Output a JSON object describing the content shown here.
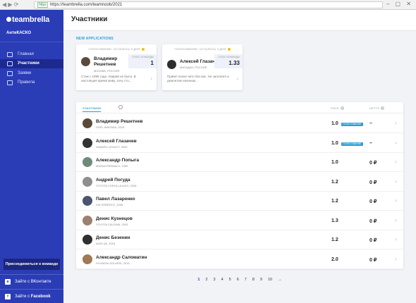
{
  "browser": {
    "nav": "◀ ▶ ⟳",
    "secure": "https",
    "url": "https://teambrella.com/teamnoob/2021",
    "controls": "– ▢ ✕"
  },
  "sidebar": {
    "logo": "teambrella",
    "team": "АнтиКАСКО",
    "items": [
      {
        "label": "Главная",
        "icon": "home-icon"
      },
      {
        "label": "Участники",
        "icon": "users-icon",
        "active": true
      },
      {
        "label": "Заявки",
        "icon": "claims-icon"
      },
      {
        "label": "Правила",
        "icon": "rules-icon"
      }
    ],
    "join_button": "Присоединиться к команде",
    "vk": "Зайти с ВКонтакте",
    "fb_prefix": "Зайти с ",
    "fb_brand": "Facebook"
  },
  "header": {
    "title": "Участники"
  },
  "applications": {
    "label": "NEW APPLICATIONS",
    "cards": [
      {
        "status": "ГОЛОСОВАНИЕ: ОСТАЛОСЬ 3 ДНЯ",
        "name": "Владимир Решетнев",
        "city": "МОСКВА, РОССИЯ",
        "vote_label": "ГОЛОС КОМАНДЫ",
        "vote": "1",
        "message": "Стаж с 1995 года. Аварий на было. В настоящее время живу, хочу сто..."
      },
      {
        "status": "ГОЛОСОВАНИЕ: ОСТАЛОСЬ 3 ДНЯ",
        "name": "Алексей Глазачев",
        "city": "МАГАДАН, РОССИЯ",
        "vote_label": "ГОЛОС КОМАНДЫ",
        "vote": "1.33",
        "message": "Привет всем! Авто без вас. Не заплатил и демонтаж начинаю..."
      }
    ]
  },
  "members": {
    "col_members": "УЧАСТНИКИ",
    "col_risk": "РИСК",
    "col_net": "НЕТТО",
    "help": "?",
    "rows": [
      {
        "name": "Владимир Решетнев",
        "car": "OPEL INSIGNIA, 2015",
        "risk": "1.0",
        "badge": "ГОЛОСОВАНИЕ",
        "net": "–",
        "avatar_color": "#5b4a3a"
      },
      {
        "name": "Алексей Глазачев",
        "car": "SUBARU LEGACY, 2002",
        "risk": "1.0",
        "badge": "ГОЛОСОВАНИЕ",
        "net": "–",
        "avatar_color": "#333333"
      },
      {
        "name": "Александр Попыга",
        "car": "MAZDA PREMACY, 1999",
        "risk": "1.0",
        "badge": "",
        "net": "0 ₽",
        "avatar_color": "#6f8a7a"
      },
      {
        "name": "Андрей Погуда",
        "car": "TOYOTA COROLLA AXIO, 2008",
        "risk": "1.2",
        "badge": "",
        "net": "0 ₽",
        "avatar_color": "#8e8e8e"
      },
      {
        "name": "Павел Лазаренко",
        "car": "KIA SORENTO, 2008",
        "risk": "1.2",
        "badge": "",
        "net": "0 ₽",
        "avatar_color": "#4a5570"
      },
      {
        "name": "Денис Кузнецов",
        "car": "TOYOTA CALDINA, 2003",
        "risk": "1.3",
        "badge": "",
        "net": "0 ₽",
        "avatar_color": "#9a8170"
      },
      {
        "name": "Денис Безенин",
        "car": "AUDI Q5, 2016",
        "risk": "1.2",
        "badge": "",
        "net": "0 ₽",
        "avatar_color": "#2f2f2f"
      },
      {
        "name": "Александр Саломатин",
        "car": "HYUNDAI SOLARIS, 2015",
        "risk": "2.0",
        "badge": "",
        "net": "0 ₽",
        "avatar_color": "#a07a55"
      }
    ]
  },
  "pagination": {
    "pages": [
      "1",
      "2",
      "3",
      "4",
      "5",
      "6",
      "7",
      "8",
      "9",
      "10"
    ],
    "current": "1",
    "next": "→"
  },
  "colors": {
    "sidebar": "#2a3cb6",
    "accent": "#2a9fd6",
    "background": "#f2f3f7"
  }
}
